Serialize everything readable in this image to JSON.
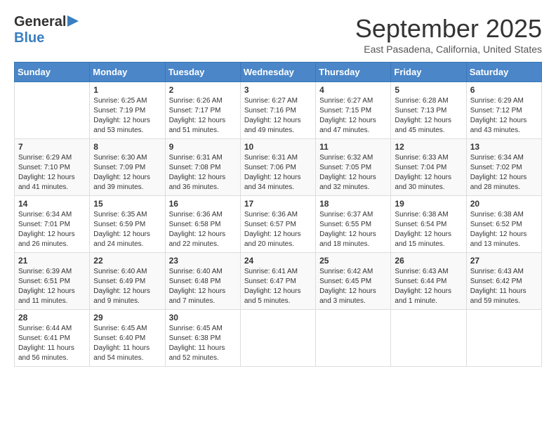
{
  "header": {
    "logo_general": "General",
    "logo_blue": "Blue",
    "month": "September 2025",
    "location": "East Pasadena, California, United States"
  },
  "weekdays": [
    "Sunday",
    "Monday",
    "Tuesday",
    "Wednesday",
    "Thursday",
    "Friday",
    "Saturday"
  ],
  "weeks": [
    [
      {
        "day": "",
        "info": ""
      },
      {
        "day": "1",
        "info": "Sunrise: 6:25 AM\nSunset: 7:19 PM\nDaylight: 12 hours\nand 53 minutes."
      },
      {
        "day": "2",
        "info": "Sunrise: 6:26 AM\nSunset: 7:17 PM\nDaylight: 12 hours\nand 51 minutes."
      },
      {
        "day": "3",
        "info": "Sunrise: 6:27 AM\nSunset: 7:16 PM\nDaylight: 12 hours\nand 49 minutes."
      },
      {
        "day": "4",
        "info": "Sunrise: 6:27 AM\nSunset: 7:15 PM\nDaylight: 12 hours\nand 47 minutes."
      },
      {
        "day": "5",
        "info": "Sunrise: 6:28 AM\nSunset: 7:13 PM\nDaylight: 12 hours\nand 45 minutes."
      },
      {
        "day": "6",
        "info": "Sunrise: 6:29 AM\nSunset: 7:12 PM\nDaylight: 12 hours\nand 43 minutes."
      }
    ],
    [
      {
        "day": "7",
        "info": "Sunrise: 6:29 AM\nSunset: 7:10 PM\nDaylight: 12 hours\nand 41 minutes."
      },
      {
        "day": "8",
        "info": "Sunrise: 6:30 AM\nSunset: 7:09 PM\nDaylight: 12 hours\nand 39 minutes."
      },
      {
        "day": "9",
        "info": "Sunrise: 6:31 AM\nSunset: 7:08 PM\nDaylight: 12 hours\nand 36 minutes."
      },
      {
        "day": "10",
        "info": "Sunrise: 6:31 AM\nSunset: 7:06 PM\nDaylight: 12 hours\nand 34 minutes."
      },
      {
        "day": "11",
        "info": "Sunrise: 6:32 AM\nSunset: 7:05 PM\nDaylight: 12 hours\nand 32 minutes."
      },
      {
        "day": "12",
        "info": "Sunrise: 6:33 AM\nSunset: 7:04 PM\nDaylight: 12 hours\nand 30 minutes."
      },
      {
        "day": "13",
        "info": "Sunrise: 6:34 AM\nSunset: 7:02 PM\nDaylight: 12 hours\nand 28 minutes."
      }
    ],
    [
      {
        "day": "14",
        "info": "Sunrise: 6:34 AM\nSunset: 7:01 PM\nDaylight: 12 hours\nand 26 minutes."
      },
      {
        "day": "15",
        "info": "Sunrise: 6:35 AM\nSunset: 6:59 PM\nDaylight: 12 hours\nand 24 minutes."
      },
      {
        "day": "16",
        "info": "Sunrise: 6:36 AM\nSunset: 6:58 PM\nDaylight: 12 hours\nand 22 minutes."
      },
      {
        "day": "17",
        "info": "Sunrise: 6:36 AM\nSunset: 6:57 PM\nDaylight: 12 hours\nand 20 minutes."
      },
      {
        "day": "18",
        "info": "Sunrise: 6:37 AM\nSunset: 6:55 PM\nDaylight: 12 hours\nand 18 minutes."
      },
      {
        "day": "19",
        "info": "Sunrise: 6:38 AM\nSunset: 6:54 PM\nDaylight: 12 hours\nand 15 minutes."
      },
      {
        "day": "20",
        "info": "Sunrise: 6:38 AM\nSunset: 6:52 PM\nDaylight: 12 hours\nand 13 minutes."
      }
    ],
    [
      {
        "day": "21",
        "info": "Sunrise: 6:39 AM\nSunset: 6:51 PM\nDaylight: 12 hours\nand 11 minutes."
      },
      {
        "day": "22",
        "info": "Sunrise: 6:40 AM\nSunset: 6:49 PM\nDaylight: 12 hours\nand 9 minutes."
      },
      {
        "day": "23",
        "info": "Sunrise: 6:40 AM\nSunset: 6:48 PM\nDaylight: 12 hours\nand 7 minutes."
      },
      {
        "day": "24",
        "info": "Sunrise: 6:41 AM\nSunset: 6:47 PM\nDaylight: 12 hours\nand 5 minutes."
      },
      {
        "day": "25",
        "info": "Sunrise: 6:42 AM\nSunset: 6:45 PM\nDaylight: 12 hours\nand 3 minutes."
      },
      {
        "day": "26",
        "info": "Sunrise: 6:43 AM\nSunset: 6:44 PM\nDaylight: 12 hours\nand 1 minute."
      },
      {
        "day": "27",
        "info": "Sunrise: 6:43 AM\nSunset: 6:42 PM\nDaylight: 11 hours\nand 59 minutes."
      }
    ],
    [
      {
        "day": "28",
        "info": "Sunrise: 6:44 AM\nSunset: 6:41 PM\nDaylight: 11 hours\nand 56 minutes."
      },
      {
        "day": "29",
        "info": "Sunrise: 6:45 AM\nSunset: 6:40 PM\nDaylight: 11 hours\nand 54 minutes."
      },
      {
        "day": "30",
        "info": "Sunrise: 6:45 AM\nSunset: 6:38 PM\nDaylight: 11 hours\nand 52 minutes."
      },
      {
        "day": "",
        "info": ""
      },
      {
        "day": "",
        "info": ""
      },
      {
        "day": "",
        "info": ""
      },
      {
        "day": "",
        "info": ""
      }
    ]
  ]
}
